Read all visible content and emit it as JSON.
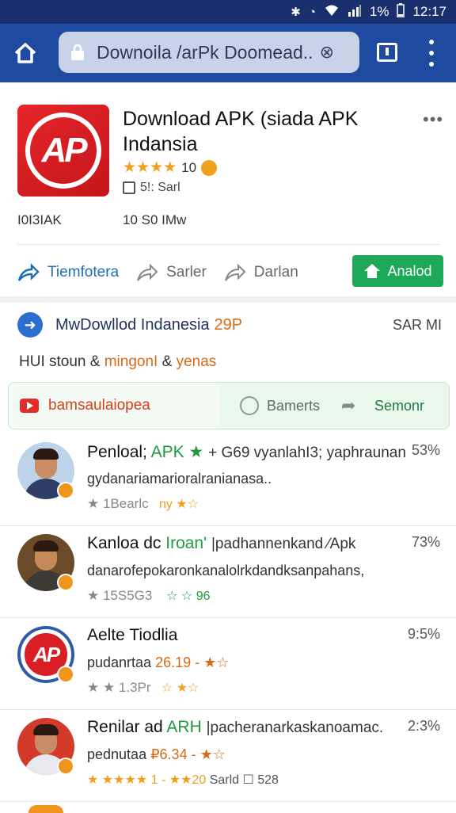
{
  "status_bar": {
    "battery": "1%",
    "time": "12:17"
  },
  "toolbar": {
    "url": "Downoila /arPk Doomead.."
  },
  "app": {
    "title": "Download APK (siada APK Indansia",
    "stars": "★★★★",
    "rating": "10",
    "size": "5!: Sarl",
    "meta_left": "I0I3IAK",
    "meta_right": "10 S0 IMw",
    "logo_text": "AP"
  },
  "actions": {
    "items": [
      {
        "label": "Tiemfotera"
      },
      {
        "label": "Sarler"
      },
      {
        "label": "Darlan"
      }
    ],
    "install_label": "Analod"
  },
  "promo": {
    "title": "MwDowllod Indanesia",
    "highlight": "29P",
    "right": "SAR MI"
  },
  "tagline": {
    "a": "HUI stoun &",
    "b": "mingonI",
    "c": "&",
    "d": "yenas"
  },
  "bar": {
    "left": "bamsaulaiopea",
    "mid": "Bamerts",
    "right": "Semonr"
  },
  "list": [
    {
      "name": "Penloal;",
      "green": "APK ★",
      "rest": "+ G69 vyanlahI3; yaphraunan",
      "pct": "53%",
      "desc": "gydanariamarioralranianasa..",
      "meta_a": "★ 1Bearlc",
      "meta_b": "ny ★☆",
      "avatar": "man-suit"
    },
    {
      "name": "Kanloa dc",
      "green": "Iroan'",
      "rest": "|padhannenkand ⁄Apk",
      "pct": "73%",
      "desc": "danarofepokaronkanalolrkdandksanpahans,",
      "meta_a": "★ 15S5G3",
      "meta_b": "☆ ☆ 96",
      "avatar": "man-casual"
    },
    {
      "name": "Aelte Tiodlia",
      "green": "",
      "rest": "",
      "pct": "9:5%",
      "desc": "pudanrtaa",
      "desc_o": "26.19 - ★☆",
      "meta_a": "★ ★ 1.3Pr",
      "meta_b": "☆ ★☆",
      "avatar": "logo"
    },
    {
      "name": "Renilar ad",
      "green": "ARH",
      "rest": "|pacheranarkaskanoamac.",
      "pct": "2:3%",
      "desc": "pednutaa",
      "desc_o": "₽6.34 - ★☆",
      "meta_a": "★ ★★★★ 1 - ★★20",
      "meta_b": "Sarld ☐ 528",
      "avatar": "man-flag"
    }
  ],
  "colors": {
    "toolbar": "#1e4aa0",
    "install": "#1ea85a",
    "accent": "#d66a16"
  }
}
